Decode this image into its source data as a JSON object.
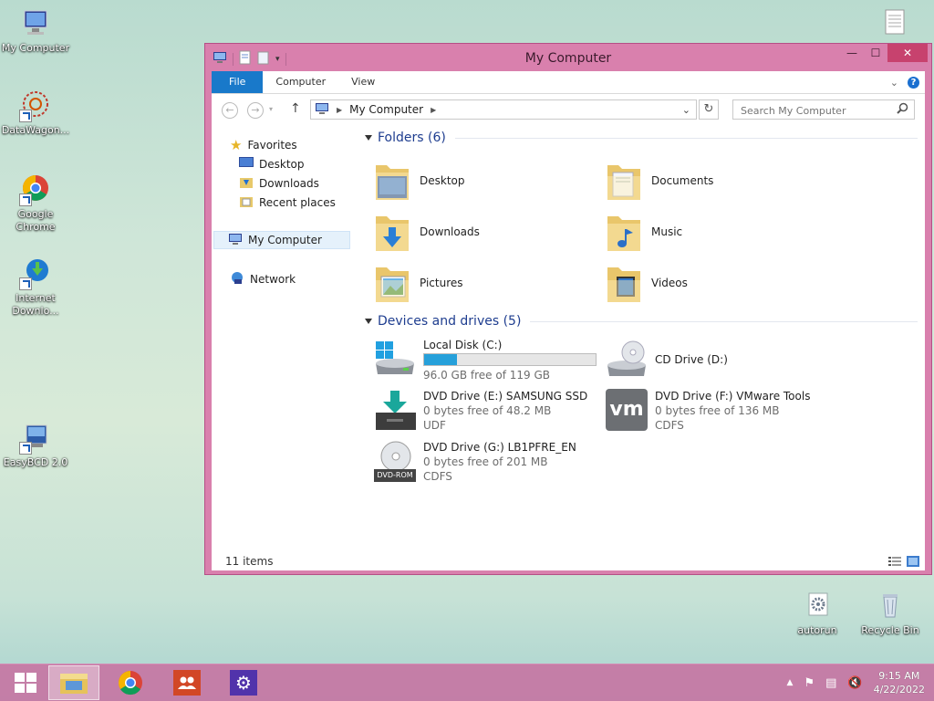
{
  "desktop": {
    "icons_left": [
      {
        "label": "My Computer"
      },
      {
        "label": "DataWagon..."
      },
      {
        "label": "Google Chrome"
      },
      {
        "label": "Internet Downlo..."
      },
      {
        "label": "EasyBCD 2.0"
      }
    ],
    "icons_right": [
      {
        "label": "..."
      },
      {
        "label": "autorun"
      },
      {
        "label": "Recycle Bin"
      }
    ]
  },
  "window": {
    "title": "My Computer",
    "controls": {
      "minimize": "—",
      "maximize": "☐",
      "close": "✕"
    },
    "ribbon_tabs": [
      "File",
      "Computer",
      "View"
    ],
    "address": {
      "path": "My Computer"
    },
    "search": {
      "placeholder": "Search My Computer"
    }
  },
  "navpane": {
    "favorites_label": "Favorites",
    "favorites": [
      "Desktop",
      "Downloads",
      "Recent places"
    ],
    "this_pc": "My Computer",
    "network": "Network"
  },
  "folders": {
    "header": "Folders (6)",
    "items": [
      "Desktop",
      "Documents",
      "Downloads",
      "Music",
      "Pictures",
      "Videos"
    ]
  },
  "drives": {
    "header": "Devices and drives (5)",
    "items": [
      {
        "name": "Local Disk (C:)",
        "line1": "96.0 GB free of 119 GB",
        "line2": "",
        "used_fraction": 0.19
      },
      {
        "name": "CD Drive (D:)",
        "line1": "",
        "line2": ""
      },
      {
        "name": "DVD Drive (E:) SAMSUNG SSD",
        "line1": "0 bytes free of 48.2 MB",
        "line2": "UDF"
      },
      {
        "name": "DVD Drive (F:) VMware Tools",
        "line1": "0 bytes free of 136 MB",
        "line2": "CDFS"
      },
      {
        "name": "DVD Drive (G:) LB1PFRE_EN",
        "line1": "0 bytes free of 201 MB",
        "line2": "CDFS"
      }
    ],
    "dvd_badge": "DVD-ROM",
    "vm_badge": "vm"
  },
  "status": {
    "items": "11 items"
  },
  "taskbar": {
    "time": "9:15 AM",
    "date": "4/22/2022"
  },
  "colors": {
    "window_frame": "#d980ad",
    "file_tab": "#1979ca",
    "group_header": "#1e3d8f",
    "disk_fill": "#26a0da"
  }
}
